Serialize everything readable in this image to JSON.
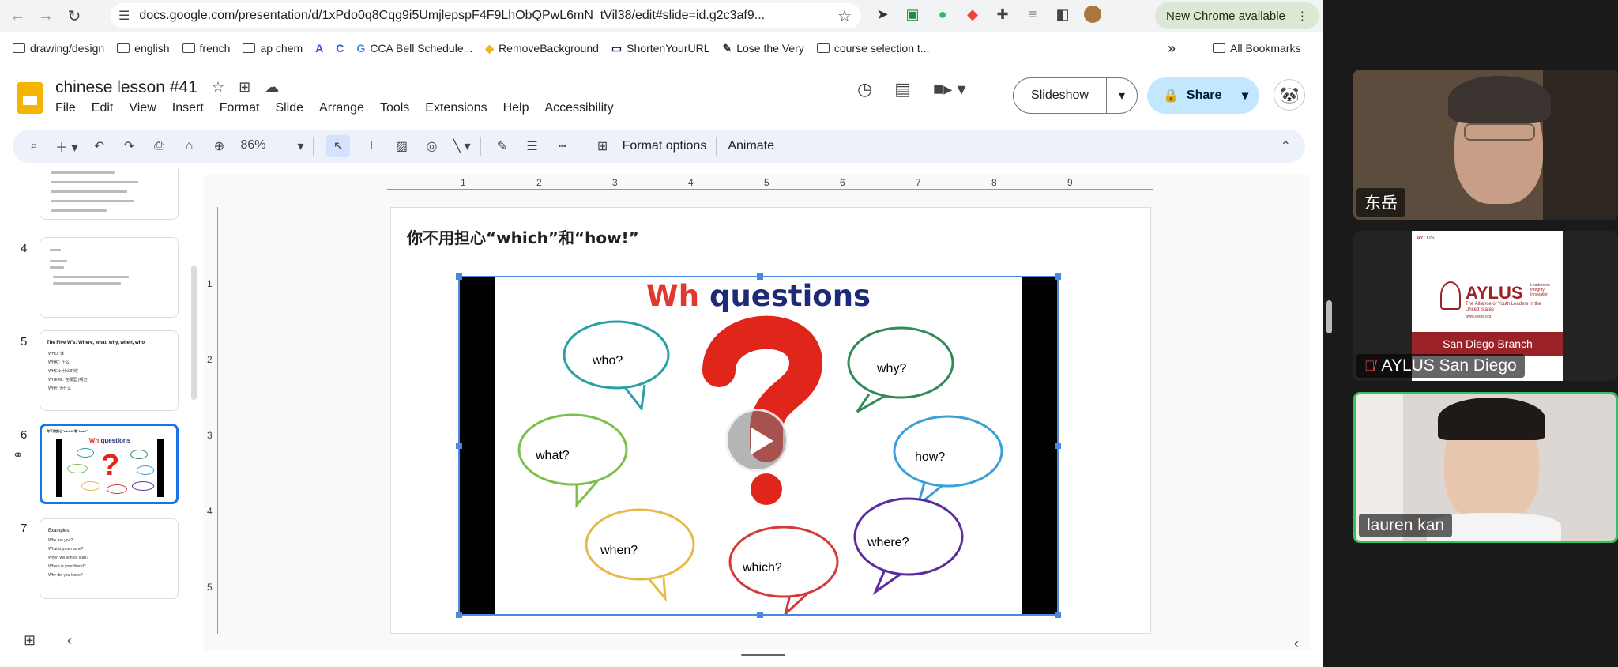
{
  "browser": {
    "url": "docs.google.com/presentation/d/1xPdo0q8Cqg9i5UmjlepspF4F9LhObQPwL6mN_tVil38/edit#slide=id.g2c3af9...",
    "update_label": "New Chrome available",
    "bookmarks": [
      {
        "label": "drawing/design",
        "icon": "folder-icon"
      },
      {
        "label": "english",
        "icon": "folder-icon"
      },
      {
        "label": "french",
        "icon": "folder-icon"
      },
      {
        "label": "ap chem",
        "icon": "folder-icon"
      },
      {
        "label": "",
        "icon": "a-logo-icon"
      },
      {
        "label": "",
        "icon": "c-logo-icon"
      },
      {
        "label": "CCA Bell Schedule...",
        "icon": "google-icon"
      },
      {
        "label": "RemoveBackground",
        "icon": "remove-bg-icon"
      },
      {
        "label": "ShortenYourURL",
        "icon": "shorten-url-icon"
      },
      {
        "label": "Lose the Very",
        "icon": "pen-icon"
      },
      {
        "label": "course selection t...",
        "icon": "folder-icon"
      }
    ],
    "all_bookmarks": "All Bookmarks"
  },
  "slides": {
    "doc_title": "chinese lesson #41",
    "menu": [
      "File",
      "Edit",
      "View",
      "Insert",
      "Format",
      "Slide",
      "Arrange",
      "Tools",
      "Extensions",
      "Help",
      "Accessibility"
    ],
    "slideshow_label": "Slideshow",
    "share_label": "Share",
    "zoom_level": "86%",
    "format_options": "Format options",
    "animate": "Animate",
    "ruler_h": [
      "1",
      "2",
      "3",
      "4",
      "5",
      "6",
      "7",
      "8",
      "9"
    ],
    "ruler_v": [
      "1",
      "2",
      "3",
      "4",
      "5"
    ]
  },
  "filmstrip": {
    "thumbs": [
      {
        "num": "",
        "selected": false
      },
      {
        "num": "4",
        "selected": false
      },
      {
        "num": "5",
        "selected": false
      },
      {
        "num": "6",
        "selected": true
      },
      {
        "num": "7",
        "selected": false
      }
    ],
    "slide5": {
      "title": "The Five W's: Where, what, why, when, who",
      "lines": [
        "WHO: 谁",
        "WHAT: 什么",
        "WHEN: 什么时候",
        "WHERE: 在哪里 (哪方)",
        "WHY: 为什么"
      ]
    },
    "slide6": {
      "title": "你不用担心\"which\"和\"how!\"",
      "wh": "Wh",
      "questions": "questions"
    },
    "slide7": {
      "title": "Examples:",
      "lines": [
        "Who are you?",
        "What is your name?",
        "When will school start?",
        "Where is your friend?",
        "Why did you leave?"
      ]
    }
  },
  "slide": {
    "title": "你不用担心“which”和“how!”",
    "video": {
      "title_wh": "Wh",
      "title_questions": "questions",
      "bubbles": [
        {
          "name": "who",
          "text": "who?",
          "color": "#2a9fa6"
        },
        {
          "name": "why",
          "text": "why?",
          "color": "#2e8b57"
        },
        {
          "name": "what",
          "text": "what?",
          "color": "#7cbf4a"
        },
        {
          "name": "how",
          "text": "how?",
          "color": "#3aa0d8"
        },
        {
          "name": "when",
          "text": "when?",
          "color": "#e8b84a"
        },
        {
          "name": "which",
          "text": "which?",
          "color": "#d43a3a"
        },
        {
          "name": "where",
          "text": "where?",
          "color": "#5b2ca0"
        }
      ],
      "question_color": "#e0251b"
    }
  },
  "zoom": {
    "participants": [
      {
        "name": "东岳",
        "muted": false,
        "active": false
      },
      {
        "name": "AYLUS San Diego",
        "muted": true,
        "active": false
      },
      {
        "name": "lauren kan",
        "muted": false,
        "active": true
      }
    ],
    "aylus_logo": {
      "small": "AYLUS",
      "big": "AYLUS",
      "tagline": "Leadership Integrity Innovation",
      "line2": "The Alliance of Youth Leaders in the United States",
      "site": "www.aylus.org",
      "branch": "San Diego Branch"
    }
  }
}
